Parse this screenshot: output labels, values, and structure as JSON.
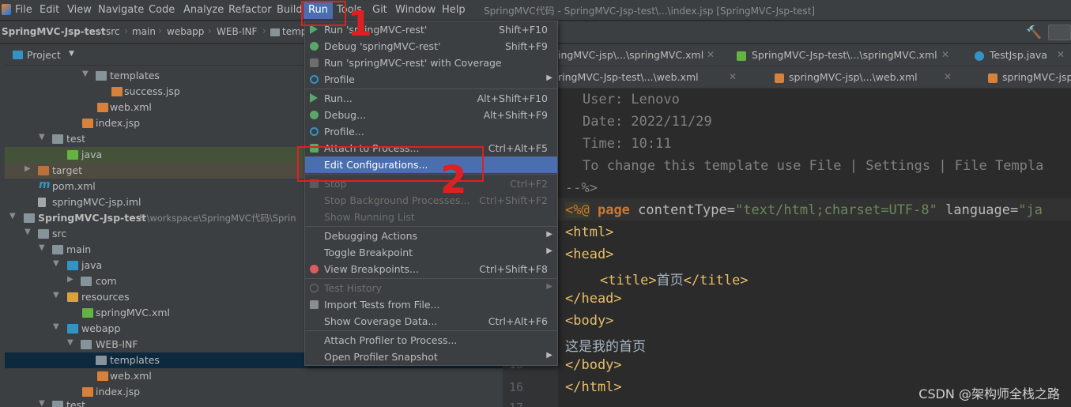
{
  "menubar": {
    "items": [
      "File",
      "Edit",
      "View",
      "Navigate",
      "Code",
      "Analyze",
      "Refactor",
      "Build",
      "Run",
      "Tools",
      "Git",
      "Window",
      "Help"
    ],
    "window_title": "SpringMVC代码 - SpringMVC-Jsp-test\\...\\index.jsp [SpringMVC-Jsp-test]"
  },
  "breadcrumb": [
    "SpringMVC-Jsp-test",
    "src",
    "main",
    "webapp",
    "WEB-INF",
    "temp"
  ],
  "project_panel": {
    "title": "Project",
    "rows": [
      {
        "label": "templates"
      },
      {
        "label": "success.jsp"
      },
      {
        "label": "web.xml"
      },
      {
        "label": "index.jsp"
      },
      {
        "label": "test"
      },
      {
        "label": "java"
      },
      {
        "label": "target"
      },
      {
        "label": "pom.xml"
      },
      {
        "label": "springMVC-jsp.iml"
      },
      {
        "label": "SpringMVC-Jsp-test",
        "path": "F:\\workspace\\SpringMVC代码\\Sprin"
      },
      {
        "label": "src"
      },
      {
        "label": "main"
      },
      {
        "label": "java"
      },
      {
        "label": "com"
      },
      {
        "label": "resources"
      },
      {
        "label": "springMVC.xml"
      },
      {
        "label": "webapp"
      },
      {
        "label": "WEB-INF"
      },
      {
        "label": "templates"
      },
      {
        "label": "web.xml"
      },
      {
        "label": "index.jsp"
      },
      {
        "label": "test"
      }
    ]
  },
  "tabs_row1": [
    {
      "label": "ingMVC-jsp\\...\\springMVC.xml"
    },
    {
      "label": "SpringMVC-Jsp-test\\...\\springMVC.xml"
    },
    {
      "label": "TestJsp.java"
    }
  ],
  "tabs_row2": [
    {
      "label": "ringMVC-Jsp-test\\...\\web.xml"
    },
    {
      "label": "springMVC-jsp\\...\\web.xml"
    },
    {
      "label": "springMVC-jsp"
    }
  ],
  "editor": {
    "comment_lines": [
      "User: Lenovo",
      "Date: 2022/11/29",
      "Time: 10:11",
      "To change this template use File | Settings | File Templa"
    ],
    "comment_close": "--%>",
    "page_directive": {
      "open": "<%@",
      "kw": "page",
      "attr1": "contentType=",
      "val1": "\"text/html;charset=UTF-8\"",
      "attr2": "language=",
      "val2": "\"ja"
    },
    "html_open": "<html>",
    "head_open": "<head>",
    "title_open": "<title>",
    "title_text": "首页",
    "title_close": "</title>",
    "head_close": "</head>",
    "body_open": "<body>",
    "body_text": "这是我的首页",
    "body_close": "</body>",
    "html_close": "</html>",
    "line_numbers": [
      "15",
      "16",
      "17"
    ]
  },
  "run_menu": {
    "items": [
      {
        "label": "Run 'springMVC-rest'",
        "shortcut": "Shift+F10"
      },
      {
        "label": "Debug 'springMVC-rest'",
        "shortcut": "Shift+F9"
      },
      {
        "label": "Run 'springMVC-rest' with Coverage",
        "shortcut": ""
      },
      {
        "label": "Profile",
        "shortcut": ""
      },
      {
        "label": "Run...",
        "shortcut": "Alt+Shift+F10"
      },
      {
        "label": "Debug...",
        "shortcut": "Alt+Shift+F9"
      },
      {
        "label": "Profile...",
        "shortcut": ""
      },
      {
        "label": "Attach to Process...",
        "shortcut": "Ctrl+Alt+F5"
      },
      {
        "label": "Edit Configurations...",
        "shortcut": ""
      },
      {
        "label": "Stop",
        "shortcut": "Ctrl+F2"
      },
      {
        "label": "Stop Background Processes...",
        "shortcut": "Ctrl+Shift+F2"
      },
      {
        "label": "Show Running List",
        "shortcut": ""
      },
      {
        "label": "Debugging Actions",
        "shortcut": ""
      },
      {
        "label": "Toggle Breakpoint",
        "shortcut": ""
      },
      {
        "label": "View Breakpoints...",
        "shortcut": "Ctrl+Shift+F8"
      },
      {
        "label": "Test History",
        "shortcut": ""
      },
      {
        "label": "Import Tests from File...",
        "shortcut": ""
      },
      {
        "label": "Show Coverage Data...",
        "shortcut": "Ctrl+Alt+F6"
      },
      {
        "label": "Attach Profiler to Process...",
        "shortcut": ""
      },
      {
        "label": "Open Profiler Snapshot",
        "shortcut": ""
      }
    ]
  },
  "annotations": {
    "one": "1",
    "two": "2"
  },
  "watermark": "CSDN @架构师全栈之路",
  "colors": {
    "accent": "#4b6eaf",
    "annotation": "#e02020",
    "background": "#2b2b2b",
    "panel": "#3c3f41"
  }
}
